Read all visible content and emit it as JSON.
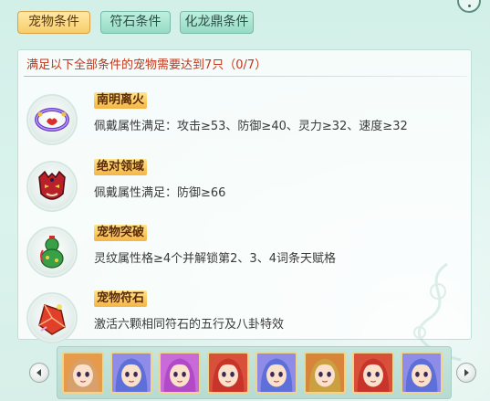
{
  "tabs": [
    {
      "label": "宠物条件",
      "active": true
    },
    {
      "label": "符石条件",
      "active": false
    },
    {
      "label": "化龙鼎条件",
      "active": false
    }
  ],
  "summary": "满足以下全部条件的宠物需要达到7只（0/7）",
  "conditions": [
    {
      "title": "南明离火",
      "desc": "佩戴属性满足：攻击≥53、防御≥40、灵力≥32、速度≥32",
      "icon": "purple-ring-accessory-icon"
    },
    {
      "title": "绝对领域",
      "desc": "佩戴属性满足：防御≥66",
      "icon": "red-demon-mask-icon"
    },
    {
      "title": "宠物突破",
      "desc": "灵纹属性格≥4个并解锁第2、3、4词条天赋格",
      "icon": "green-gourd-icon"
    },
    {
      "title": "宠物符石",
      "desc": "激活六颗相同符石的五行及八卦特效",
      "icon": "red-rune-stone-icon"
    }
  ],
  "pets": [
    {
      "icon": "fox-pet-icon",
      "bg": "#e69a4a",
      "hair": "#d8a06a"
    },
    {
      "icon": "blue-hair-girl-pet-icon",
      "bg": "#8f8ce8",
      "hair": "#5d6fd8"
    },
    {
      "icon": "pink-hair-girl-pet-icon",
      "bg": "#c86ad8",
      "hair": "#b24ac8"
    },
    {
      "icon": "red-warrior-pet-icon",
      "bg": "#d8503a",
      "hair": "#c8342a"
    },
    {
      "icon": "blue-hair-girl-pet-icon",
      "bg": "#8f8ce8",
      "hair": "#5d6fd8"
    },
    {
      "icon": "gold-helmet-warrior-pet-icon",
      "bg": "#d8843a",
      "hair": "#caa040"
    },
    {
      "icon": "red-warrior-pet-icon",
      "bg": "#d8503a",
      "hair": "#c8342a"
    },
    {
      "icon": "blue-hair-girl-pet-icon",
      "bg": "#8f8ce8",
      "hair": "#5d6fd8"
    }
  ],
  "colors": {
    "accent_red": "#c2361c",
    "tab_active": "#f7cd6a",
    "tab_inactive": "#95dbc4"
  }
}
